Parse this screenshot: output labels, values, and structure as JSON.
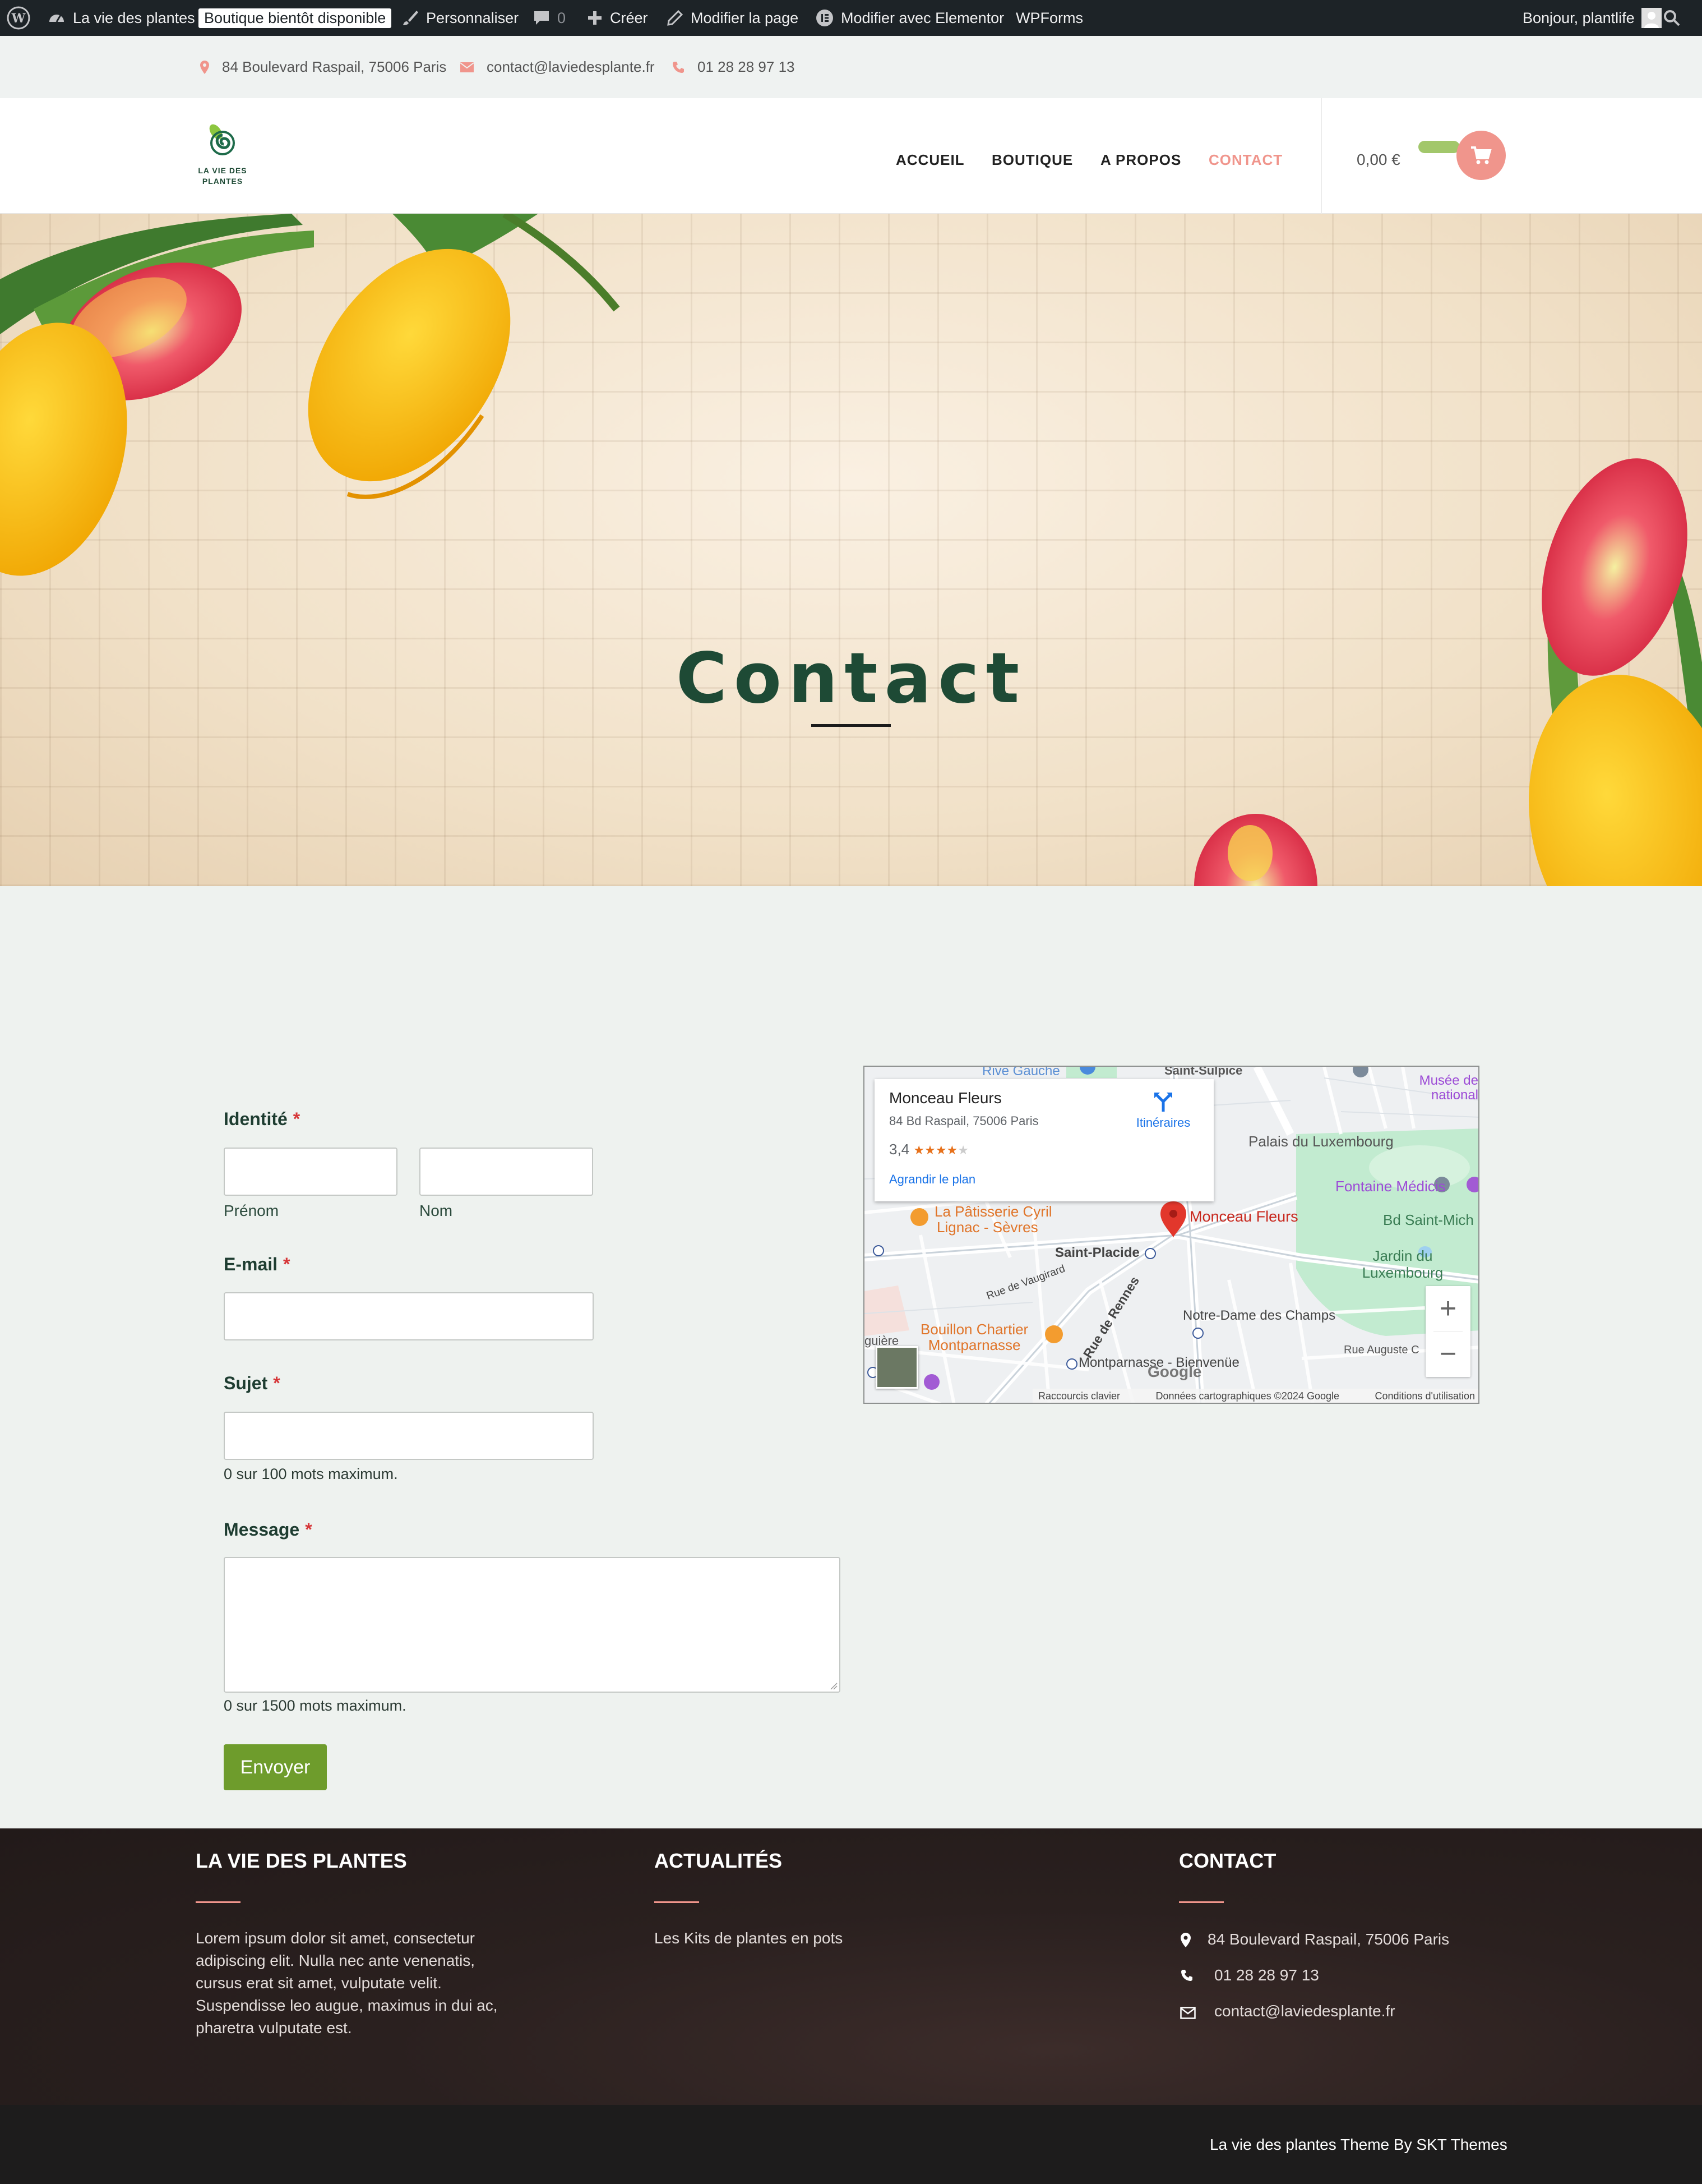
{
  "adminbar": {
    "site_name": "La vie des plantes",
    "maintenance_badge": "Boutique bientôt disponible",
    "customize": "Personnaliser",
    "comments_count": "0",
    "new": "Créer",
    "edit_page": "Modifier la page",
    "edit_elementor": "Modifier avec Elementor",
    "wpforms": "WPForms",
    "greeting": "Bonjour, plantlife"
  },
  "topinfo": {
    "address": "84 Boulevard Raspail, 75006 Paris",
    "email": "contact@laviedesplante.fr",
    "phone": "01 28 28 97 13"
  },
  "header": {
    "logo_line1": "LA VIE DES",
    "logo_line2": "PLANTES",
    "nav": [
      "ACCUEIL",
      "BOUTIQUE",
      "A PROPOS",
      "CONTACT"
    ],
    "cart_total": "0,00 €"
  },
  "hero": {
    "title": "Contact"
  },
  "form": {
    "identity_label": "Identité",
    "first_name_sub": "Prénom",
    "last_name_sub": "Nom",
    "email_label": "E-mail",
    "subject_label": "Sujet",
    "subject_help": "0 sur 100 mots maximum.",
    "message_label": "Message",
    "message_help": "0 sur 1500 mots maximum.",
    "required_mark": "*",
    "submit_label": "Envoyer"
  },
  "map": {
    "place_name": "Monceau Fleurs",
    "place_address": "84 Bd Raspail, 75006 Paris",
    "rating": "3,4",
    "stars": "★★★★",
    "stars_empty": "★",
    "directions": "Itinéraires",
    "enlarge": "Agrandir le plan",
    "labels": {
      "rive_gauche": "Rive Gauche",
      "saint_sulpice": "Saint-Sulpice",
      "musee_1": "Musée de",
      "musee_2": "national",
      "palais": "Palais du Luxembourg",
      "fontaine": "Fontaine Médicis",
      "bd_saint_mich": "Bd Saint-Mich",
      "jardin_1": "Jardin du",
      "jardin_2": "Luxembourg",
      "patisserie_1": "La Pâtisserie Cyril",
      "patisserie_2": "Lignac - Sèvres",
      "marker_label": "Monceau Fleurs",
      "saint_placide": "Saint-Placide",
      "rue_vaugirard": "Rue de Vaugirard",
      "rue_rennes": "Rue de Rennes",
      "notre_dame": "Notre-Dame des Champs",
      "bouillon_1": "Bouillon Chartier",
      "bouillon_2": "Montparnasse",
      "montparnasse": "Montparnasse - Bienvenüe",
      "rue_auguste": "Rue Auguste C",
      "guiere": "guière"
    },
    "google": "Google",
    "footer_shortcuts": "Raccourcis clavier",
    "footer_data": "Données cartographiques ©2024 Google",
    "footer_terms": "Conditions d'utilisation",
    "zoom_in": "+",
    "zoom_out": "−"
  },
  "footer": {
    "col1_title": "LA VIE DES PLANTES",
    "col1_text": "Lorem ipsum dolor sit amet, consectetur adipiscing elit. Nulla nec ante venenatis, cursus erat sit amet, vulputate velit. Suspendisse leo augue, maximus in dui ac, pharetra vulputate est.",
    "col2_title": "ACTUALITÉS",
    "col2_link": "Les Kits de plantes en pots",
    "col3_title": "CONTACT",
    "col3_address": "84 Boulevard Raspail, 75006 Paris",
    "col3_phone": "01 28 28 97 13",
    "col3_email": "contact@laviedesplante.fr",
    "credits": "La vie des plantes Theme By SKT Themes"
  },
  "colors": {
    "accent_salmon": "#f0958c",
    "heading_green": "#1e4a35",
    "submit_green": "#6e9c2c",
    "adminbar": "#1d2327"
  }
}
